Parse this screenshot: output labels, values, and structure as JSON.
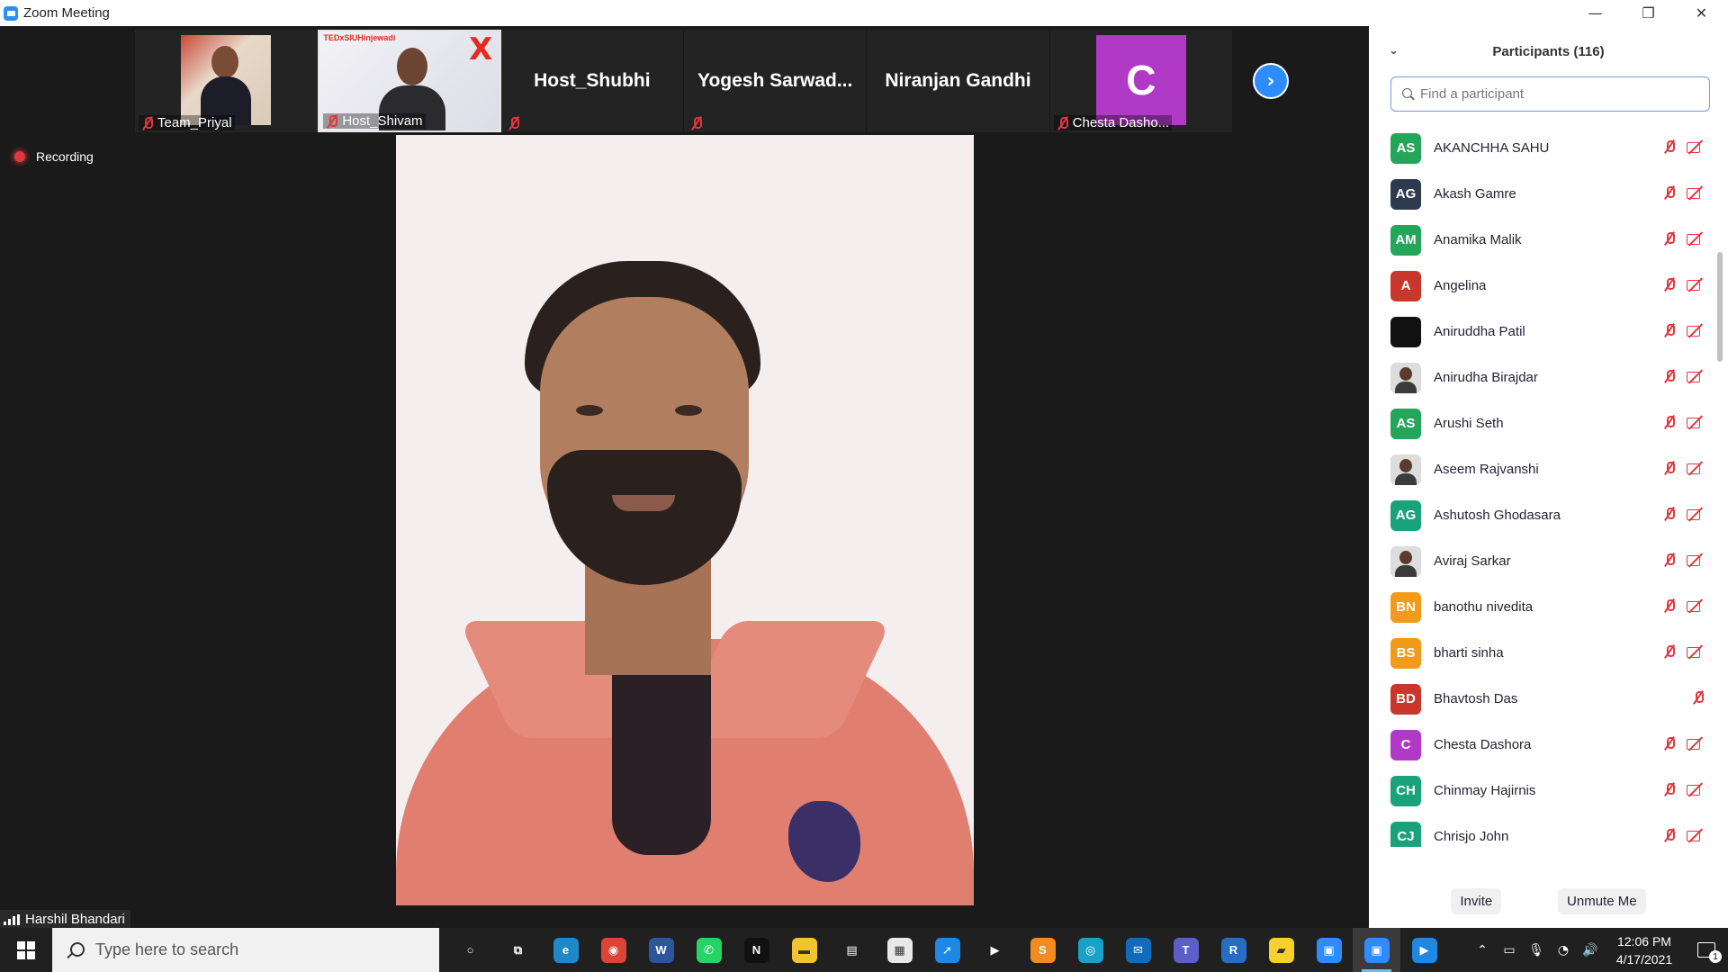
{
  "window": {
    "title": "Zoom Meeting",
    "minimize_glyph": "—",
    "restore_glyph": "❐",
    "close_glyph": "✕"
  },
  "strip": {
    "tiles": [
      {
        "name": "Team_Priyal",
        "type": "video",
        "muted": true
      },
      {
        "name": "Host_Shivam",
        "type": "video",
        "muted": true,
        "active": true,
        "logo_text": "TEDxSIUHinjewadi",
        "logo_mark": "X"
      },
      {
        "name": "Host_Shubhi",
        "type": "name",
        "muted": true
      },
      {
        "name": "Yogesh  Sarwad...",
        "type": "name",
        "muted": true
      },
      {
        "name": "Niranjan Gandhi",
        "type": "name",
        "muted": false
      },
      {
        "name": "Chesta Dasho...",
        "type": "avatar",
        "initial": "C",
        "muted": true,
        "color": "#B03AC6"
      }
    ],
    "next_glyph": "›"
  },
  "recording": {
    "label": "Recording"
  },
  "active_speaker": {
    "name": "Harshil Bhandari"
  },
  "participants": {
    "title": "Participants (116)",
    "collapse_glyph": "⌄",
    "search_placeholder": "Find a participant",
    "list": [
      {
        "initials": "AS",
        "name": "AKANCHHA SAHU",
        "color": "#23A55A",
        "mic_muted": true,
        "cam_off": true
      },
      {
        "initials": "AG",
        "name": "Akash Gamre",
        "color": "#2E3B4E",
        "mic_muted": true,
        "cam_off": true
      },
      {
        "initials": "AM",
        "name": "Anamika Malik",
        "color": "#23A55A",
        "mic_muted": true,
        "cam_off": true
      },
      {
        "initials": "A",
        "name": "Angelina",
        "color": "#C9372C",
        "mic_muted": true,
        "cam_off": true
      },
      {
        "initials": "",
        "name": "Aniruddha Patil",
        "color": "#111111",
        "mic_muted": true,
        "cam_off": true
      },
      {
        "initials": "",
        "name": "Anirudha Birajdar",
        "color": "photo",
        "mic_muted": true,
        "cam_off": true
      },
      {
        "initials": "AS",
        "name": "Arushi Seth",
        "color": "#23A55A",
        "mic_muted": true,
        "cam_off": true
      },
      {
        "initials": "",
        "name": "Aseem Rajvanshi",
        "color": "photo",
        "mic_muted": true,
        "cam_off": true
      },
      {
        "initials": "AG",
        "name": "Ashutosh Ghodasara",
        "color": "#1AA37A",
        "mic_muted": true,
        "cam_off": true
      },
      {
        "initials": "",
        "name": "Aviraj Sarkar",
        "color": "photo",
        "mic_muted": true,
        "cam_off": true
      },
      {
        "initials": "BN",
        "name": "banothu nivedita",
        "color": "#F29A1A",
        "mic_muted": true,
        "cam_off": true
      },
      {
        "initials": "BS",
        "name": "bharti sinha",
        "color": "#F29A1A",
        "mic_muted": true,
        "cam_off": true
      },
      {
        "initials": "BD",
        "name": "Bhavtosh Das",
        "color": "#C9372C",
        "mic_muted": true,
        "cam_off": false
      },
      {
        "initials": "C",
        "name": "Chesta Dashora",
        "color": "#B03AC6",
        "mic_muted": true,
        "cam_off": true
      },
      {
        "initials": "CH",
        "name": "Chinmay Hajirnis",
        "color": "#1AA37A",
        "mic_muted": true,
        "cam_off": true
      },
      {
        "initials": "CJ",
        "name": "Chrisjo John",
        "color": "#1AA37A",
        "mic_muted": true,
        "cam_off": true
      }
    ],
    "invite_label": "Invite",
    "unmute_label": "Unmute Me"
  },
  "taskbar": {
    "search_placeholder": "Type here to search",
    "apps": [
      {
        "icon": "cortana-icon",
        "glyph": "○",
        "color": "transparent"
      },
      {
        "icon": "task-view-icon",
        "glyph": "⧉",
        "color": "transparent"
      },
      {
        "icon": "edge-icon",
        "glyph": "e",
        "color": "#1E88C8"
      },
      {
        "icon": "chrome-icon",
        "glyph": "◉",
        "color": "#DB4437"
      },
      {
        "icon": "word-icon",
        "glyph": "W",
        "color": "#2B579A"
      },
      {
        "icon": "whatsapp-icon",
        "glyph": "✆",
        "color": "#25D366"
      },
      {
        "icon": "netflix-icon",
        "glyph": "N",
        "color": "#111111"
      },
      {
        "icon": "file-explorer-icon",
        "glyph": "▬",
        "color": "#F4C430"
      },
      {
        "icon": "document-icon",
        "glyph": "▤",
        "color": "transparent"
      },
      {
        "icon": "store-icon",
        "glyph": "▦",
        "color": "#E8E8E8"
      },
      {
        "icon": "safari-icon",
        "glyph": "➚",
        "color": "#1E88E5"
      },
      {
        "icon": "prime-video-icon",
        "glyph": "▶",
        "color": "transparent"
      },
      {
        "icon": "sublime-icon",
        "glyph": "S",
        "color": "#F28B20"
      },
      {
        "icon": "instagram-icon",
        "glyph": "◎",
        "color": "#1BA1C7"
      },
      {
        "icon": "outlook-icon",
        "glyph": "✉",
        "color": "#0F6CBD"
      },
      {
        "icon": "teams-icon",
        "glyph": "T",
        "color": "#5B5FC7"
      },
      {
        "icon": "r-icon",
        "glyph": "R",
        "color": "#276DC3"
      },
      {
        "icon": "sticky-notes-icon",
        "glyph": "▰",
        "color": "#F7D02C"
      },
      {
        "icon": "zoom-icon",
        "glyph": "▣",
        "color": "#2D8CFF"
      },
      {
        "icon": "zoom-meeting-icon",
        "glyph": "▣",
        "color": "#2D8CFF",
        "active": true
      },
      {
        "icon": "media-player-icon",
        "glyph": "▶",
        "color": "#1E88E5"
      }
    ],
    "tray": {
      "chevron_glyph": "⌃",
      "time": "12:06 PM",
      "date": "4/17/2021",
      "notification_count": "1"
    }
  }
}
